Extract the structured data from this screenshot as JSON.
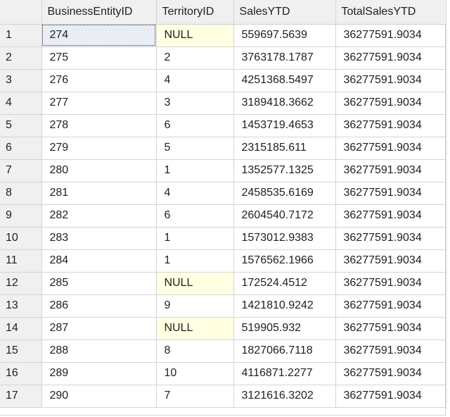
{
  "grid": {
    "columns": [
      "",
      "BusinessEntityID",
      "TerritoryID",
      "SalesYTD",
      "TotalSalesYTD"
    ],
    "rows": [
      {
        "row_number": "1",
        "BusinessEntityID": "274",
        "TerritoryID": "NULL",
        "SalesYTD": "559697.5639",
        "TotalSalesYTD": "36277591.9034"
      },
      {
        "row_number": "2",
        "BusinessEntityID": "275",
        "TerritoryID": "2",
        "SalesYTD": "3763178.1787",
        "TotalSalesYTD": "36277591.9034"
      },
      {
        "row_number": "3",
        "BusinessEntityID": "276",
        "TerritoryID": "4",
        "SalesYTD": "4251368.5497",
        "TotalSalesYTD": "36277591.9034"
      },
      {
        "row_number": "4",
        "BusinessEntityID": "277",
        "TerritoryID": "3",
        "SalesYTD": "3189418.3662",
        "TotalSalesYTD": "36277591.9034"
      },
      {
        "row_number": "5",
        "BusinessEntityID": "278",
        "TerritoryID": "6",
        "SalesYTD": "1453719.4653",
        "TotalSalesYTD": "36277591.9034"
      },
      {
        "row_number": "6",
        "BusinessEntityID": "279",
        "TerritoryID": "5",
        "SalesYTD": "2315185.611",
        "TotalSalesYTD": "36277591.9034"
      },
      {
        "row_number": "7",
        "BusinessEntityID": "280",
        "TerritoryID": "1",
        "SalesYTD": "1352577.1325",
        "TotalSalesYTD": "36277591.9034"
      },
      {
        "row_number": "8",
        "BusinessEntityID": "281",
        "TerritoryID": "4",
        "SalesYTD": "2458535.6169",
        "TotalSalesYTD": "36277591.9034"
      },
      {
        "row_number": "9",
        "BusinessEntityID": "282",
        "TerritoryID": "6",
        "SalesYTD": "2604540.7172",
        "TotalSalesYTD": "36277591.9034"
      },
      {
        "row_number": "10",
        "BusinessEntityID": "283",
        "TerritoryID": "1",
        "SalesYTD": "1573012.9383",
        "TotalSalesYTD": "36277591.9034"
      },
      {
        "row_number": "11",
        "BusinessEntityID": "284",
        "TerritoryID": "1",
        "SalesYTD": "1576562.1966",
        "TotalSalesYTD": "36277591.9034"
      },
      {
        "row_number": "12",
        "BusinessEntityID": "285",
        "TerritoryID": "NULL",
        "SalesYTD": "172524.4512",
        "TotalSalesYTD": "36277591.9034"
      },
      {
        "row_number": "13",
        "BusinessEntityID": "286",
        "TerritoryID": "9",
        "SalesYTD": "1421810.9242",
        "TotalSalesYTD": "36277591.9034"
      },
      {
        "row_number": "14",
        "BusinessEntityID": "287",
        "TerritoryID": "NULL",
        "SalesYTD": "519905.932",
        "TotalSalesYTD": "36277591.9034"
      },
      {
        "row_number": "15",
        "BusinessEntityID": "288",
        "TerritoryID": "8",
        "SalesYTD": "1827066.7118",
        "TotalSalesYTD": "36277591.9034"
      },
      {
        "row_number": "16",
        "BusinessEntityID": "289",
        "TerritoryID": "10",
        "SalesYTD": "4116871.2277",
        "TotalSalesYTD": "36277591.9034"
      },
      {
        "row_number": "17",
        "BusinessEntityID": "290",
        "TerritoryID": "7",
        "SalesYTD": "3121616.3202",
        "TotalSalesYTD": "36277591.9034"
      }
    ],
    "selected_cell": {
      "row": 0,
      "column": "BusinessEntityID"
    },
    "colors": {
      "header_background": "#f0f0f0",
      "null_cell_background": "#ffffe1",
      "grid_line": "#d4d4d4"
    }
  }
}
